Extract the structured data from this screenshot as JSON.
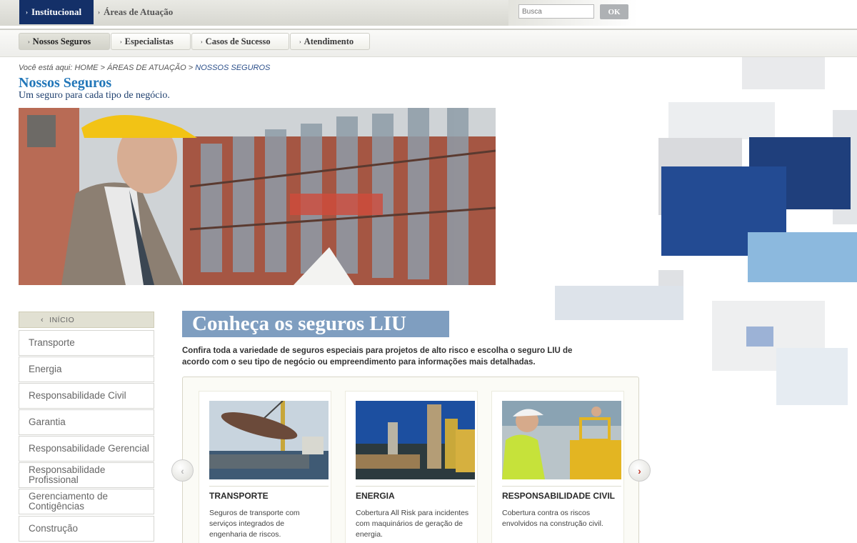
{
  "top_nav": {
    "tabs": [
      {
        "label": "Institucional"
      },
      {
        "label": "Áreas de Atuação"
      }
    ],
    "search": {
      "placeholder": "Busca",
      "button": "OK"
    }
  },
  "sub_nav": {
    "tabs": [
      {
        "label": "Nossos Seguros"
      },
      {
        "label": "Especialistas"
      },
      {
        "label": "Casos de Sucesso"
      },
      {
        "label": "Atendimento"
      }
    ]
  },
  "breadcrumb": {
    "prefix": "Você está aqui:",
    "home": "HOME",
    "areas": "ÁREAS DE ATUAÇÃO",
    "current": "NOSSOS SEGUROS",
    "separator": ">"
  },
  "page": {
    "title": "Nossos Seguros",
    "subtitle": "Um seguro para cada tipo de negócio."
  },
  "sidebar": {
    "home": "INÍCIO",
    "items": [
      {
        "label": "Transporte"
      },
      {
        "label": "Energia"
      },
      {
        "label": "Responsabilidade Civil"
      },
      {
        "label": "Garantia"
      },
      {
        "label": "Responsabilidade Gerencial"
      },
      {
        "label": "Responsabilidade Profissional"
      },
      {
        "label": "Gerenciamento de Contigências"
      },
      {
        "label": "Construção"
      }
    ]
  },
  "main": {
    "banner": "Conheça os seguros LIU",
    "intro": "Confira toda a variedade de seguros especiais para projetos de alto risco e escolha o seguro LIU de acordo com o seu tipo de negócio ou empreendimento para informações mais detalhadas.",
    "cards": [
      {
        "title": "TRANSPORTE",
        "desc": "Seguros de transporte com serviços integrados de engenharia de riscos."
      },
      {
        "title": "ENERGIA",
        "desc": "Cobertura All Risk para incidentes com maquinários de geração de energia."
      },
      {
        "title": "RESPONSABILIDADE CIVIL",
        "desc": "Cobertura contra os riscos envolvidos na construção civil."
      }
    ]
  },
  "colors": {
    "brand_navy": "#143068",
    "title_blue": "#2277b9",
    "banner_blue": "#7f9ec0"
  }
}
